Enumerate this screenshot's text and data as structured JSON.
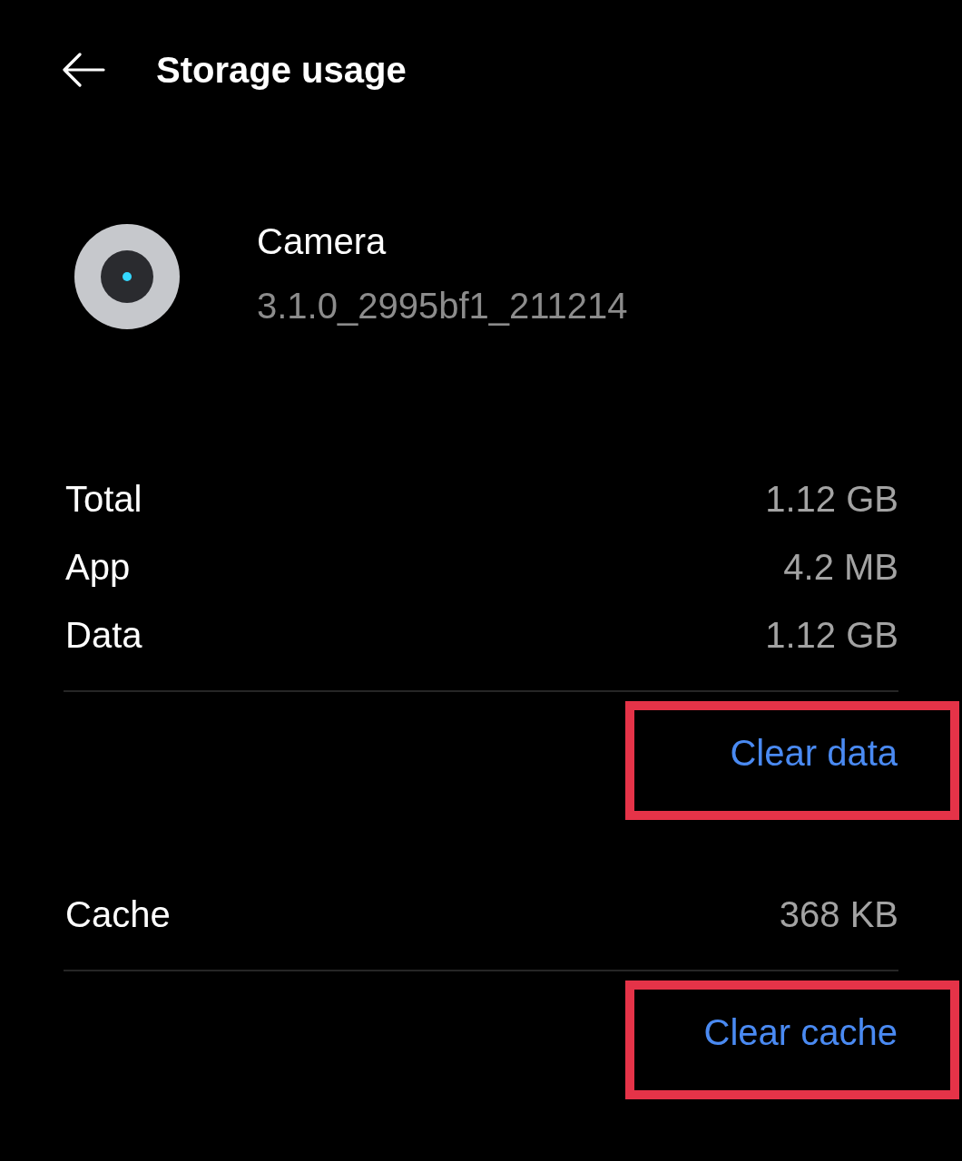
{
  "header": {
    "title": "Storage usage"
  },
  "app": {
    "name": "Camera",
    "version": "3.1.0_2995bf1_211214"
  },
  "sections": [
    {
      "rows": [
        {
          "label": "Total",
          "value": "1.12 GB"
        },
        {
          "label": "App",
          "value": "4.2 MB"
        },
        {
          "label": "Data",
          "value": "1.12 GB"
        }
      ],
      "action": {
        "label": "Clear data",
        "highlighted": true
      }
    },
    {
      "rows": [
        {
          "label": "Cache",
          "value": "368 KB"
        }
      ],
      "action": {
        "label": "Clear cache",
        "highlighted": true
      }
    }
  ]
}
